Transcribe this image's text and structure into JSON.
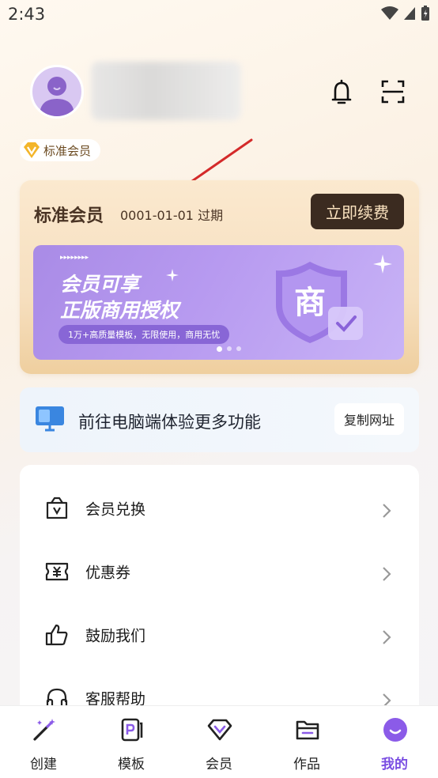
{
  "status_bar": {
    "time": "2:43"
  },
  "header": {
    "member_level": "标准会员"
  },
  "member_card": {
    "title": "标准会员",
    "expiry": "0001-01-01 过期",
    "renew_label": "立即续费",
    "banner": {
      "line1": "会员可享",
      "line2": "正版商用授权",
      "pill_text": "1万+高质量模板，无限使用，商用无忧",
      "shield_char": "商"
    }
  },
  "desktop_promo": {
    "text": "前往电脑端体验更多功能",
    "copy_label": "复制网址"
  },
  "menu": {
    "items": [
      {
        "label": "会员兑换",
        "icon": "voucher-bag-icon"
      },
      {
        "label": "优惠券",
        "icon": "coupon-icon"
      },
      {
        "label": "鼓励我们",
        "icon": "thumbs-up-icon"
      },
      {
        "label": "客服帮助",
        "icon": "headset-icon"
      }
    ]
  },
  "tabbar": {
    "tabs": [
      {
        "label": "创建",
        "icon": "magic-wand-icon"
      },
      {
        "label": "模板",
        "icon": "template-icon"
      },
      {
        "label": "会员",
        "icon": "diamond-icon"
      },
      {
        "label": "作品",
        "icon": "folder-icon"
      },
      {
        "label": "我的",
        "icon": "profile-icon",
        "active": true
      }
    ]
  },
  "colors": {
    "accent": "#7a4ee2",
    "renew_bg": "#3b2b20",
    "card_gold": "#f6dfbf",
    "arrow": "#d42a2a"
  }
}
